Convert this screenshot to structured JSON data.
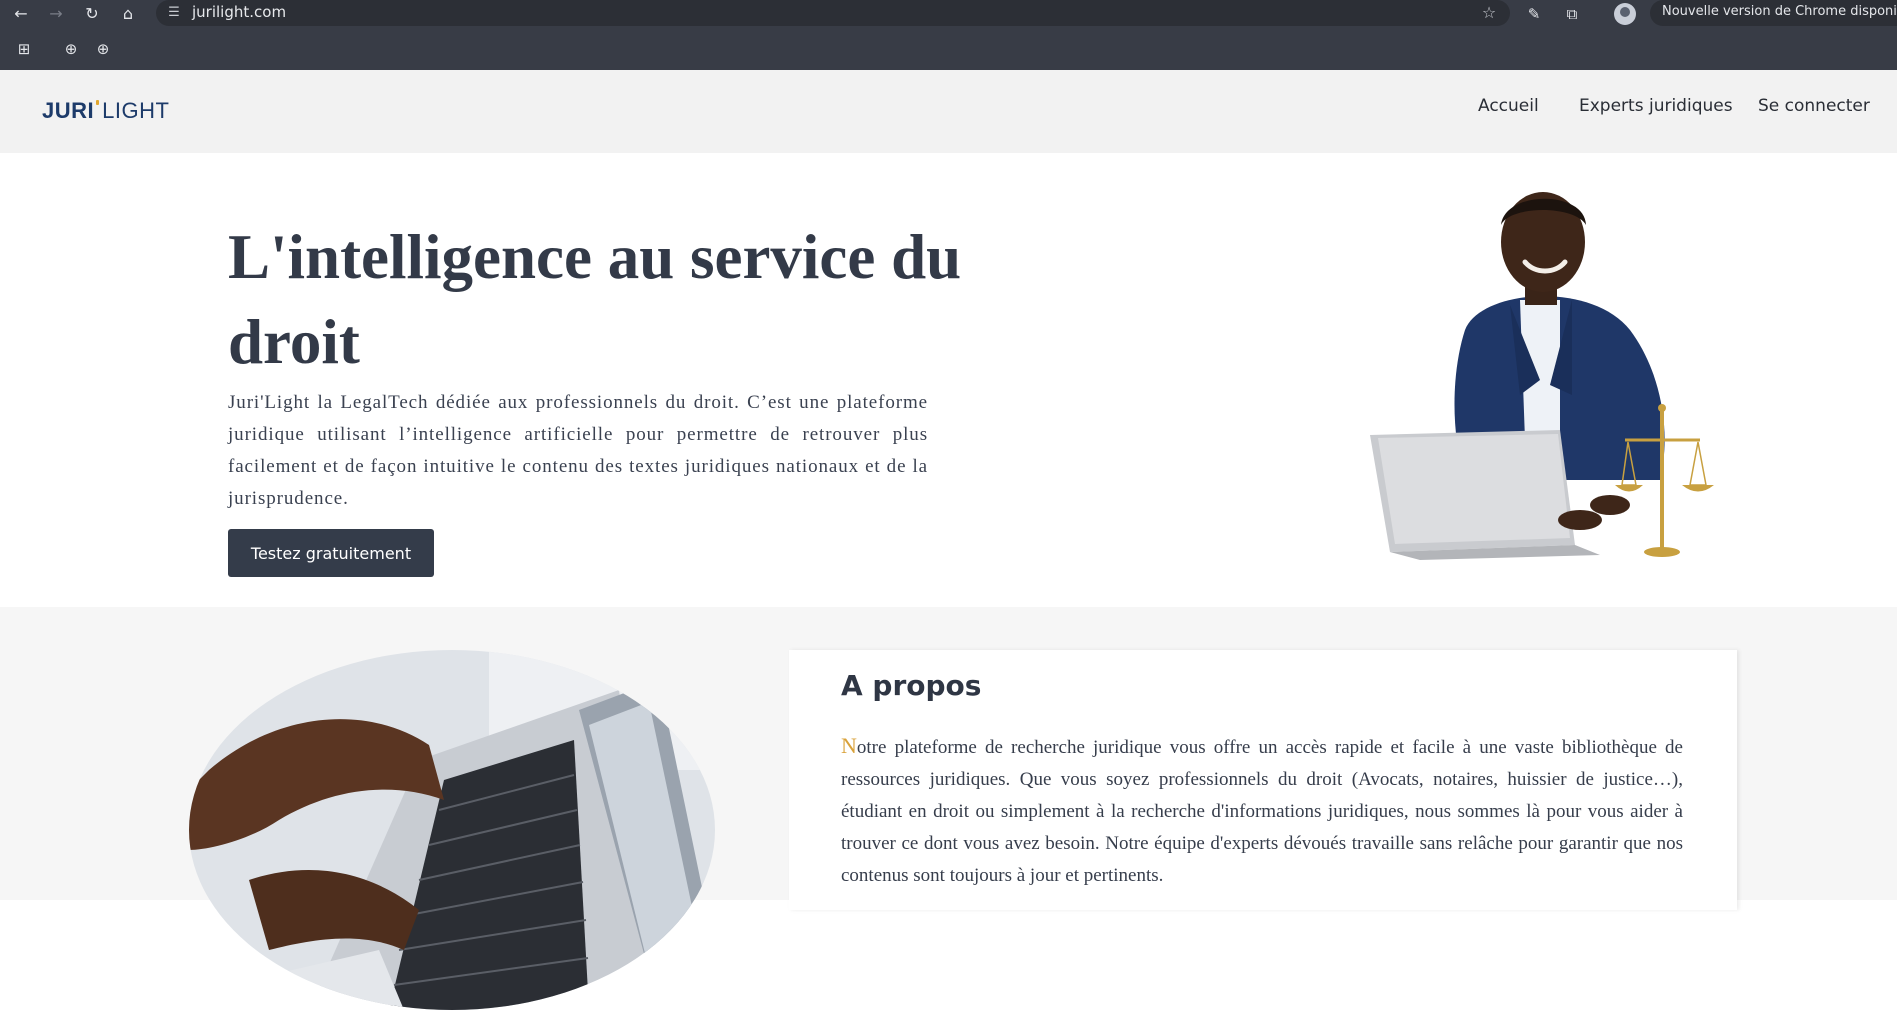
{
  "browser": {
    "url": "jurilight.com",
    "update_label": "Nouvelle version de Chrome disponible",
    "icons": {
      "back": "back-arrow-icon",
      "forward": "forward-arrow-icon",
      "reload": "reload-icon",
      "home": "home-icon",
      "site_info": "tune-icon",
      "bookmark_star": "star-icon",
      "pen": "pen-icon",
      "extensions": "puzzle-icon",
      "apps": "apps-grid-icon",
      "bookmark_globe": "globe-icon"
    }
  },
  "header": {
    "logo_bold": "JURI",
    "logo_light": "LIGHT",
    "nav": [
      {
        "label": "Accueil"
      },
      {
        "label": "Experts juridiques"
      },
      {
        "label": "Se connecter"
      }
    ]
  },
  "hero": {
    "title": "L'intelligence au service du droit",
    "description": "Juri'Light la LegalTech dédiée aux professionnels du droit. C’est une plateforme juridique utilisant l’intelligence artificielle pour permettre de retrouver plus facilement et de façon intuitive le contenu des textes juridiques nationaux et de la jurisprudence.",
    "cta_label": "Testez gratuitement"
  },
  "about": {
    "title": "A propos",
    "dropcap": "N",
    "text": "otre plateforme de recherche juridique vous offre un accès rapide et facile à une vaste bibliothèque de ressources juridiques. Que vous soyez professionnels du droit (Avocats, notaires, huissier de justice…), étudiant en droit ou simplement à la recherche d'informations juridiques, nous sommes là pour vous aider à trouver ce dont vous avez besoin. Notre équipe d'experts dévoués travaille sans relâche pour garantir que nos contenus sont toujours à jour et pertinents."
  },
  "colors": {
    "chrome_bg": "#383c46",
    "header_bg": "#f2f2f2",
    "text_dark": "#333a48",
    "button_bg": "#343c4a",
    "accent_gold": "#d9a23a",
    "logo_blue": "#1d3b6a"
  }
}
